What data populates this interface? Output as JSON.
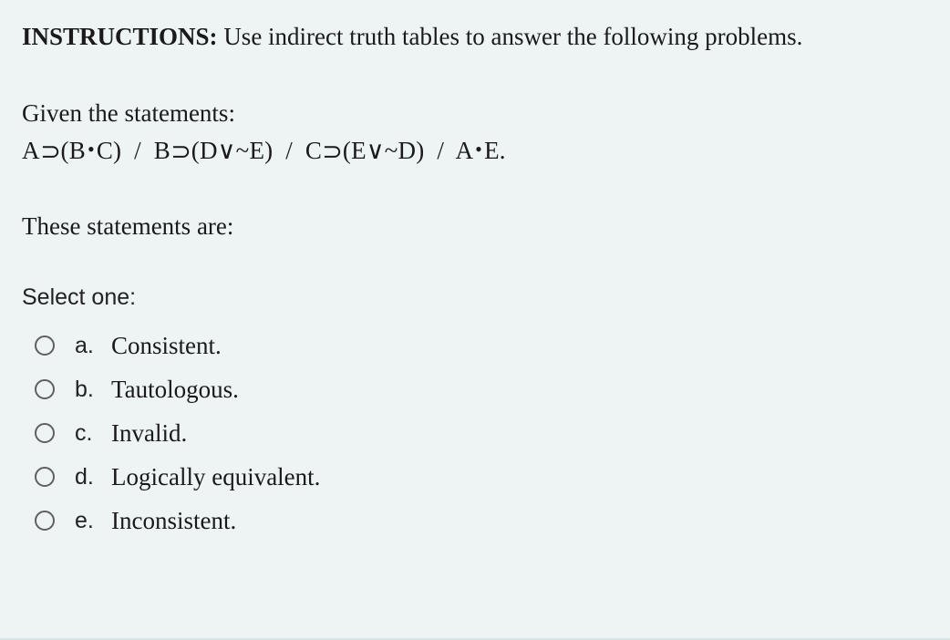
{
  "instructions_label": "INSTRUCTIONS:",
  "instructions_text": "Use indirect truth tables to answer the following problems.",
  "given_label": "Given the statements:",
  "statements_plain": "A⊃(B • C)  /  B⊃(D∨~E)  /  C⊃(E∨~D)  /  A • E.",
  "these_label": "These statements are:",
  "select_one": "Select one:",
  "options": [
    {
      "letter": "a.",
      "label": "Consistent."
    },
    {
      "letter": "b.",
      "label": "Tautologous."
    },
    {
      "letter": "c.",
      "label": "Invalid."
    },
    {
      "letter": "d.",
      "label": "Logically equivalent."
    },
    {
      "letter": "e.",
      "label": "Inconsistent."
    }
  ]
}
